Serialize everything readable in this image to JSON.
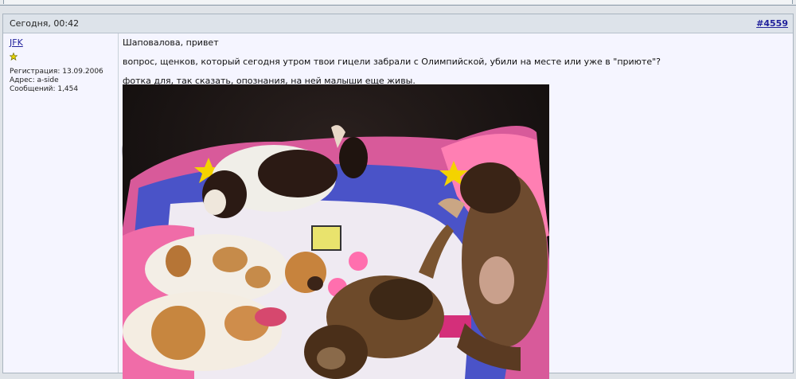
{
  "post": {
    "date": "Сегодня, 00:42",
    "number_hash": "#",
    "number": "4559"
  },
  "user": {
    "name": "JFK",
    "registration": "Регистрация: 13.09.2006",
    "address": "Адрес: a-side",
    "messages": "Сообщений: 1,454"
  },
  "message": {
    "line1": "Шаповалова, привет",
    "line2": "вопрос, щенков, который сегодня утром твои гицели забрали с Олимпийской, убили на месте или уже в \"приюте\"?",
    "line3": "фотка для, так сказать, опознания, на ней малыши еще живы."
  },
  "colors": {
    "link": "#22229c",
    "header_bg": "#dde3ea",
    "post_bg": "#f5f5ff"
  },
  "icons": {
    "rank": "star-icon"
  }
}
